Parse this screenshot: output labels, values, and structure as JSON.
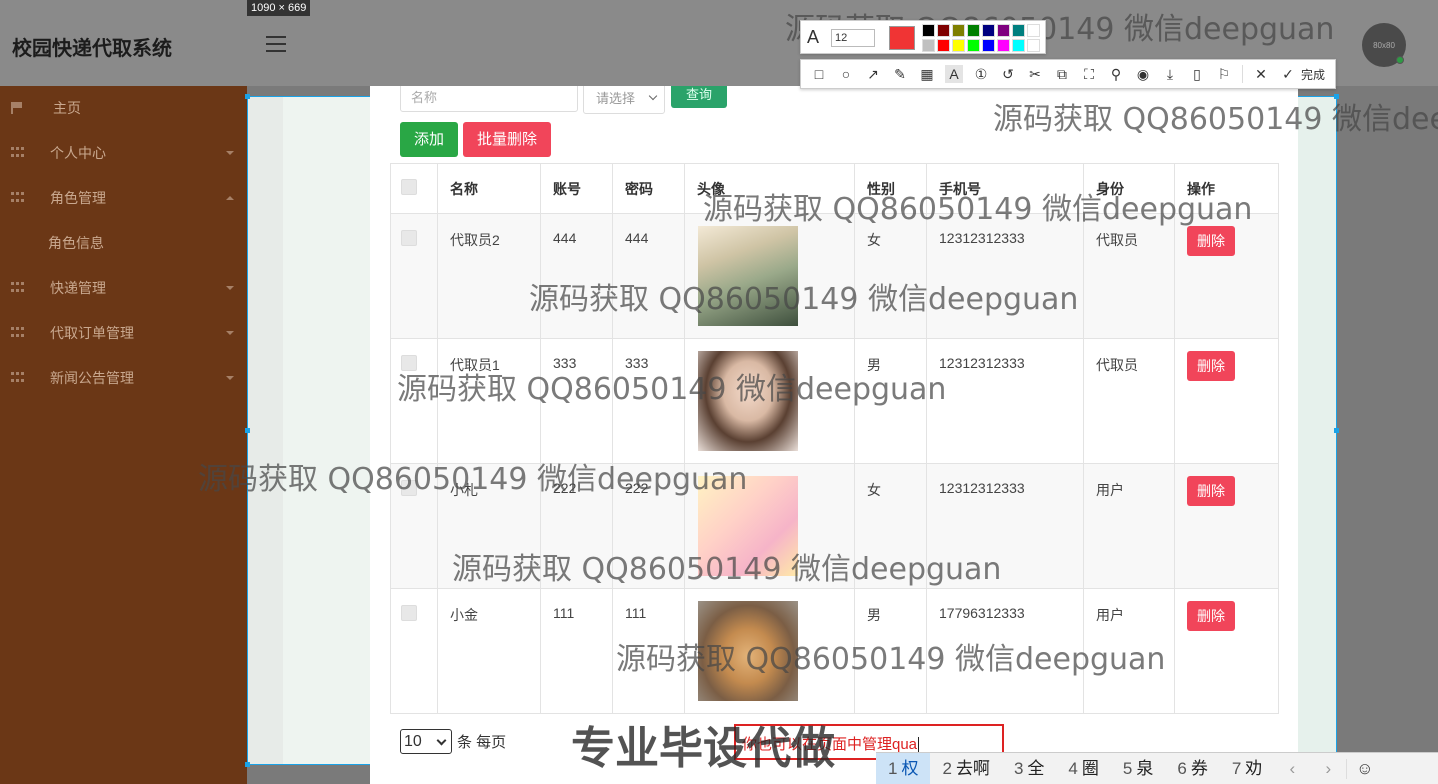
{
  "app": {
    "title": "校园快递代取系统",
    "avatar_text": "80x80"
  },
  "capture": {
    "size_label": "1090 × 669"
  },
  "sidebar": {
    "items": [
      {
        "label": "主页",
        "icon": "flag-icon",
        "expandable": false
      },
      {
        "label": "个人中心",
        "icon": "grid-icon",
        "expandable": true
      },
      {
        "label": "角色管理",
        "icon": "grid-icon",
        "expandable": true,
        "expanded": true
      },
      {
        "label": "角色信息",
        "icon": "",
        "expandable": false,
        "sub": true
      },
      {
        "label": "快递管理",
        "icon": "grid-icon",
        "expandable": true
      },
      {
        "label": "代取订单管理",
        "icon": "grid-icon",
        "expandable": true
      },
      {
        "label": "新闻公告管理",
        "icon": "grid-icon",
        "expandable": true
      }
    ]
  },
  "search": {
    "name_placeholder": "名称",
    "select_placeholder": "请选择",
    "query_label": "查询"
  },
  "toolbar": {
    "add_label": "添加",
    "batch_delete_label": "批量删除"
  },
  "table": {
    "headers": [
      "",
      "名称",
      "账号",
      "密码",
      "头像",
      "性别",
      "手机号",
      "身份",
      "操作"
    ],
    "rows": [
      {
        "name": "代取员2",
        "account": "444",
        "password": "444",
        "gender": "女",
        "phone": "12312312333",
        "role": "代取员",
        "action": "删除"
      },
      {
        "name": "代取员1",
        "account": "333",
        "password": "333",
        "gender": "男",
        "phone": "12312312333",
        "role": "代取员",
        "action": "删除"
      },
      {
        "name": "小札",
        "account": "222",
        "password": "222",
        "gender": "女",
        "phone": "12312312333",
        "role": "用户",
        "action": "删除"
      },
      {
        "name": "小金",
        "account": "111",
        "password": "111",
        "gender": "男",
        "phone": "17796312333",
        "role": "用户",
        "action": "删除"
      }
    ]
  },
  "pager": {
    "page_size": "10",
    "per_page_label": "条 每页"
  },
  "annotation": {
    "text": "你也可以在页面中管理qua"
  },
  "screenshot_tool": {
    "font_size": "12",
    "current_color": "#f03434",
    "palette": [
      "#000000",
      "#7f0000",
      "#7f7f00",
      "#007f00",
      "#00007f",
      "#7f007f",
      "#007f7f",
      "#ffffff",
      "#c0c0c0",
      "#ff0000",
      "#ffff00",
      "#00ff00",
      "#0000ff",
      "#ff00ff",
      "#00ffff",
      "#ffffff"
    ],
    "done_label": "完成",
    "tools": [
      "rectangle-icon",
      "ellipse-icon",
      "arrow-icon",
      "pen-icon",
      "mosaic-icon",
      "text-icon",
      "number-icon",
      "undo-icon",
      "crop-icon",
      "ocr-icon",
      "scan-icon",
      "pin-icon",
      "record-icon",
      "download-icon",
      "phone-icon",
      "bookmark-icon",
      "close-icon",
      "check-icon"
    ]
  },
  "ime": {
    "candidates": [
      {
        "num": "1",
        "text": "权"
      },
      {
        "num": "2",
        "text": "去啊"
      },
      {
        "num": "3",
        "text": "全"
      },
      {
        "num": "4",
        "text": "圈"
      },
      {
        "num": "5",
        "text": "泉"
      },
      {
        "num": "6",
        "text": "券"
      },
      {
        "num": "7",
        "text": "劝"
      }
    ]
  },
  "watermark": {
    "text": "源码获取 QQ86050149 微信deepguan",
    "big_text": "专业毕设代做"
  }
}
